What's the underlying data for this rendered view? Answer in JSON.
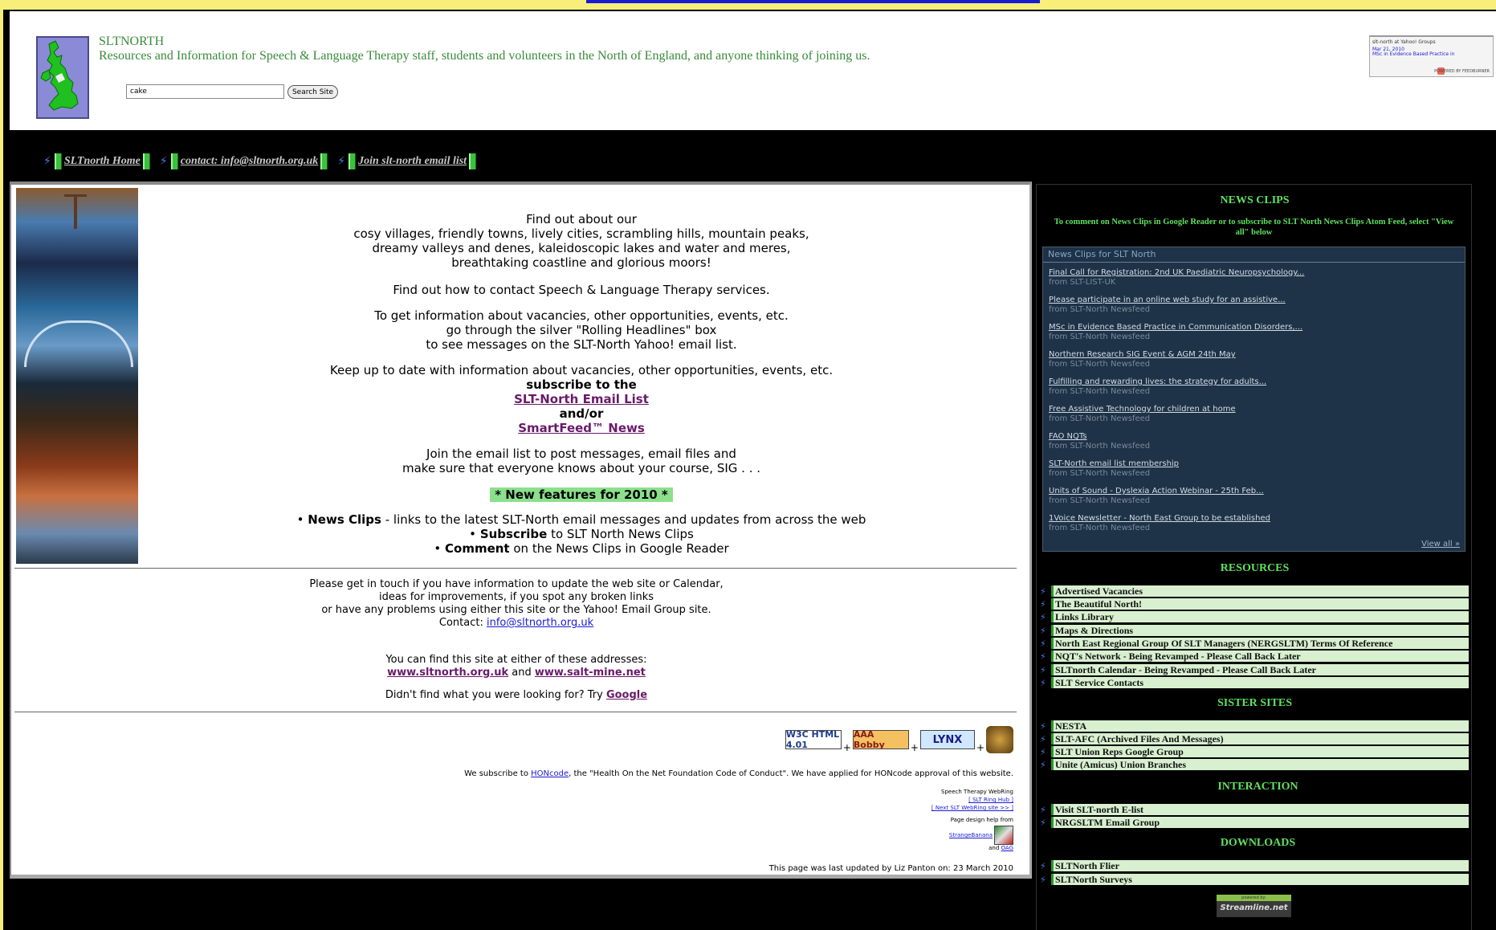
{
  "header": {
    "site_name": "SLTNORTH",
    "tagline": "Resources and Information for Speech & Language Therapy staff, students and volunteers in the North of England, and anyone thinking of joining us.",
    "search_value": "cake",
    "search_button": "Search Site"
  },
  "yahoo_box": {
    "title": "slt-north at Yahoo! Groups",
    "date": "Mar 21, 2010",
    "article": "MSc in Evidence Based Practice in",
    "powered": "POWERED BY FEEDBURNER"
  },
  "nav": {
    "home": "SLTnorth Home",
    "contact": "contact: info@sltnorth.org.uk",
    "join": "Join slt-north email list"
  },
  "main": {
    "p1_l1": "Find out about our",
    "p1_l2": "cosy villages, friendly towns, lively cities, scrambling hills, mountain peaks,",
    "p1_l3": "dreamy valleys and denes, kaleidoscopic lakes and water and meres,",
    "p1_l4": "breathtaking coastline and glorious moors!",
    "p2": "Find out how to contact Speech & Language Therapy services.",
    "p3_l1": "To get information about vacancies, other opportunities, events, etc.",
    "p3_l2": "go through the silver \"Rolling Headlines\" box",
    "p3_l3": "to see messages on the SLT-North Yahoo! email list.",
    "p4_l1": "Keep up to date with information about vacancies, other opportunities, events, etc.",
    "p4_l2": "subscribe to the",
    "p4_link1": "SLT-North Email List",
    "p4_and": "and/or",
    "p4_link2": "SmartFeed™ News",
    "p5_l1": "Join the email list to post messages, email files and",
    "p5_l2": "make sure that everyone knows about your course, SIG . . .",
    "new_features": "* New features for 2010 *",
    "feat1_bold": "News Clips",
    "feat1_text": " - links to the latest SLT-North email messages and updates from across the web",
    "feat2_bold": "Subscribe",
    "feat2_text": " to SLT North News Clips",
    "feat3_bold": "Comment",
    "feat3_text": " on the News Clips in Google Reader",
    "bullet": "•"
  },
  "contact_section": {
    "l1": "Please get in touch if you have information to update the web site or Calendar,",
    "l2": "ideas for improvements, if you spot any broken links",
    "l3": "or have any problems using either this site or the Yahoo! Email Group site.",
    "l4_label": "Contact: ",
    "l4_link": "info@sltnorth.org.uk",
    "addr_intro": "You can find this site at either of these addresses:",
    "addr1": "www.sltnorth.org.uk",
    "addr_and": " and ",
    "addr2": "www.salt-mine.net",
    "google_pre": "Didn't find what you were looking for? Try ",
    "google_link": "Google"
  },
  "footer": {
    "badge_w3c": "W3C HTML 4.01",
    "badge_bobby": "AAA Bobby",
    "badge_lynx": "LYNX",
    "plus": "+",
    "hon_pre": "We subscribe to ",
    "hon_link": "HONcode",
    "hon_post": ", the \"Health On the Net Foundation Code of Conduct\". We have applied for HONcode approval of this website.",
    "webring_title": "Speech Therapy WebRing",
    "ring_hub": "[ SLT Ring Hub ]",
    "ring_next": "[ Next SLT WebRing site >> ]",
    "design_help": "Page design help from",
    "designer": "StrangeBanana",
    "and_text": "and ",
    "oag": "OAG",
    "updated": "This page was last updated by Liz Panton on: 23 March 2010"
  },
  "sidebar": {
    "news_title": "NEWS CLIPS",
    "news_sub": "To comment on News Clips in Google Reader or  to subscribe to SLT North News Clips Atom Feed, select \"View all\" below",
    "news_box_title": "News Clips for SLT North",
    "clips": [
      {
        "title": "Final Call for Registration: 2nd UK Paediatric Neuropsychology...",
        "source": "from SLT-LIST-UK"
      },
      {
        "title": "Please participate in an online web study for an assistive...",
        "source": "from SLT-North Newsfeed"
      },
      {
        "title": "MSc in Evidence Based Practice in Communication Disorders,...",
        "source": "from SLT-North Newsfeed"
      },
      {
        "title": "Northern Research SIG Event & AGM 24th May",
        "source": "from SLT-North Newsfeed"
      },
      {
        "title": "Fulfilling and rewarding lives: the strategy for adults...",
        "source": "from SLT-North Newsfeed"
      },
      {
        "title": "Free Assistive Technology for children at home",
        "source": "from SLT-North Newsfeed"
      },
      {
        "title": "FAO NQTs",
        "source": "from SLT-North Newsfeed"
      },
      {
        "title": "SLT-North email list membership",
        "source": "from SLT-North Newsfeed"
      },
      {
        "title": "Units of Sound - Dyslexia Action Webinar - 25th Feb...",
        "source": "from SLT-North Newsfeed"
      },
      {
        "title": "1Voice Newsletter - North East Group to be established",
        "source": "from SLT-North Newsfeed"
      }
    ],
    "view_all": "View all »",
    "resources_title": "RESOURCES",
    "resources": [
      "Advertised Vacancies",
      "The Beautiful North!",
      "Links Library",
      "Maps & Directions",
      "North East Regional Group Of SLT Managers (NERGSLTM) Terms Of Reference",
      "NQT's Network - Being Revamped - Please Call Back Later",
      "SLTnorth Calendar - Being Revamped - Please Call Back Later",
      "SLT Service Contacts"
    ],
    "sister_title": "SISTER SITES",
    "sister": [
      "NESTA",
      "SLT-AFC (Archived Files And Messages)",
      "SLT Union Reps Google Group",
      "Unite (Amicus) Union Branches"
    ],
    "interaction_title": "INTERACTION",
    "interaction": [
      "Visit SLT-north E-list",
      "NRGSLTM Email Group"
    ],
    "downloads_title": "DOWNLOADS",
    "downloads": [
      "SLTNorth Flier",
      "SLTNorth Surveys"
    ],
    "powered_by": "powered by:",
    "streamline": "Streamline.net"
  },
  "icons": {
    "nav_icon": "⚡",
    "list_icon": "⚡"
  },
  "colors": {
    "heading_green": "#5fe05f",
    "tagline_green": "#3a8a3a",
    "link_purple": "#6a1a6a",
    "link_blue": "#1a1ad6",
    "page_yellow": "#f7ef7a"
  }
}
